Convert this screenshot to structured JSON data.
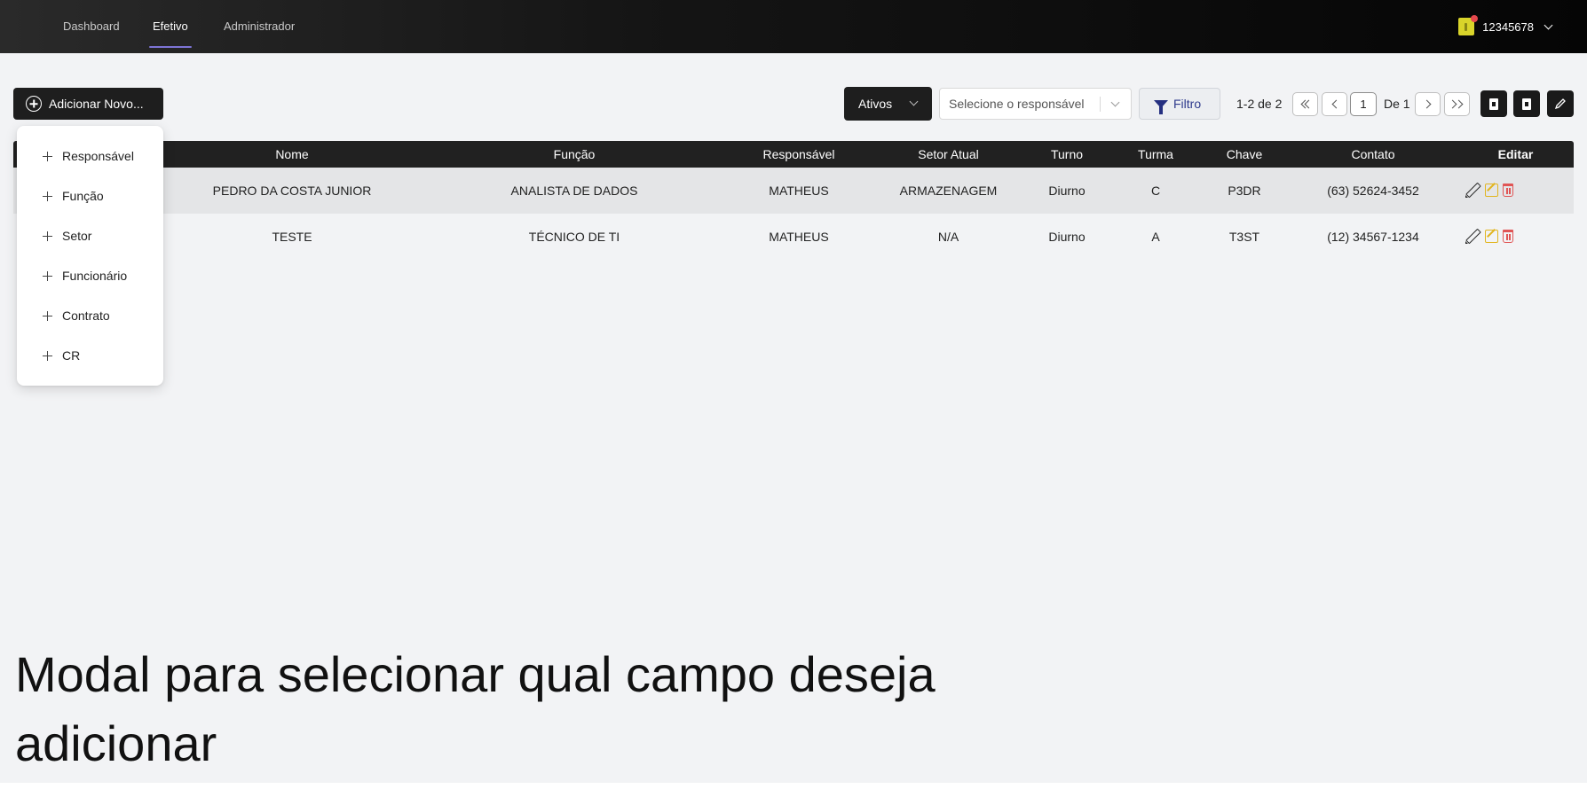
{
  "nav": {
    "links": [
      "Dashboard",
      "Efetivo",
      "Administrador"
    ],
    "active": "Efetivo",
    "user_id": "12345678"
  },
  "toolbar": {
    "add_label": "Adicionar Novo...",
    "status_value": "Ativos",
    "responsavel_placeholder": "Selecione o responsável",
    "filter_label": "Filtro",
    "page_range": "1-2 de 2",
    "current_page": "1",
    "page_of": "De 1"
  },
  "table": {
    "headers": [
      "Nome",
      "Função",
      "Responsável",
      "Setor Atual",
      "Turno",
      "Turma",
      "Chave",
      "Contato",
      "Editar"
    ],
    "rows": [
      {
        "nome": "PEDRO DA COSTA JUNIOR",
        "funcao": "ANALISTA DE DADOS",
        "responsavel": "MATHEUS",
        "setor": "ARMAZENAGEM",
        "turno": "Diurno",
        "turma": "C",
        "chave": "P3DR",
        "contato": "(63) 52624-3452"
      },
      {
        "nome": "TESTE",
        "funcao": "TÉCNICO DE TI",
        "responsavel": "MATHEUS",
        "setor": "N/A",
        "turno": "Diurno",
        "turma": "A",
        "chave": "T3ST",
        "contato": "(12) 34567-1234"
      }
    ]
  },
  "menu": {
    "items": [
      "Responsável",
      "Função",
      "Setor",
      "Funcionário",
      "Contrato",
      "CR"
    ]
  },
  "caption": "Modal para selecionar qual campo deseja adicionar",
  "icons": {
    "add": "plus-circle-icon",
    "filter": "funnel-icon",
    "export": "document-icon",
    "edit": "pencil-icon",
    "delete": "trash-icon"
  },
  "colors": {
    "topbar": "#151515",
    "active_underline": "#7d74d6",
    "filter_text": "#2e3a8c",
    "edit_yellow": "#e1b520",
    "delete_red": "#e05555",
    "notification_dot": "#e5484d"
  }
}
